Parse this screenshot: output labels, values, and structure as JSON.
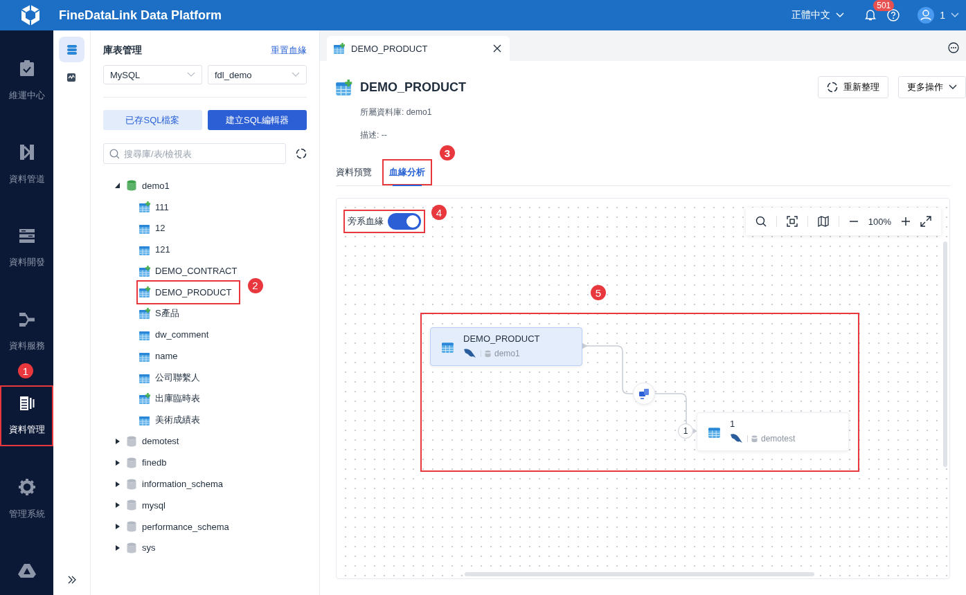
{
  "header": {
    "title": "FineDataLink Data Platform",
    "language": "正體中文",
    "notification_count": "501",
    "user": "1"
  },
  "nav": {
    "items": [
      {
        "label": "維運中心",
        "selected": false,
        "highlighted": false
      },
      {
        "label": "資料管道",
        "selected": false,
        "highlighted": false
      },
      {
        "label": "資料開發",
        "selected": false,
        "highlighted": false
      },
      {
        "label": "資料服務",
        "selected": false,
        "highlighted": false
      },
      {
        "label": "資料管理",
        "selected": true,
        "highlighted": true,
        "callout": "1"
      },
      {
        "label": "管理系統",
        "selected": false,
        "highlighted": false
      }
    ]
  },
  "rail": {
    "items": [
      {
        "selected": true
      },
      {
        "selected": false
      }
    ]
  },
  "panel": {
    "title": "庫表管理",
    "link": "重置血緣",
    "source_select": "MySQL",
    "database_select": "fdl_demo",
    "buttons": [
      {
        "label": "已存SQL檔案",
        "kind": "secondary"
      },
      {
        "label": "建立SQL編輯器",
        "kind": "primary"
      }
    ],
    "search": {
      "placeholder": "搜尋庫/表/檢視表"
    },
    "tree": [
      {
        "label": "demo1",
        "expanded": true,
        "children": [
          {
            "label": "111",
            "kind": "table-linked",
            "highlighted": false
          },
          {
            "label": "12",
            "kind": "table",
            "highlighted": false
          },
          {
            "label": "121",
            "kind": "table",
            "highlighted": false
          },
          {
            "label": "DEMO_CONTRACT",
            "kind": "table-linked",
            "highlighted": false
          },
          {
            "label": "DEMO_PRODUCT",
            "kind": "table-linked",
            "highlighted": true,
            "callout": "2"
          },
          {
            "label": "S產品",
            "kind": "table-linked",
            "highlighted": false
          },
          {
            "label": "dw_comment",
            "kind": "table",
            "highlighted": false
          },
          {
            "label": "name",
            "kind": "table",
            "highlighted": false
          },
          {
            "label": "公司聯繫人",
            "kind": "table",
            "highlighted": false
          },
          {
            "label": "出庫臨時表",
            "kind": "table-linked",
            "highlighted": false
          },
          {
            "label": "美術成績表",
            "kind": "table",
            "highlighted": false
          }
        ]
      },
      {
        "label": "demotest",
        "expanded": false
      },
      {
        "label": "finedb",
        "expanded": false
      },
      {
        "label": "information_schema",
        "expanded": false
      },
      {
        "label": "mysql",
        "expanded": false
      },
      {
        "label": "performance_schema",
        "expanded": false
      },
      {
        "label": "sys",
        "expanded": false
      }
    ]
  },
  "document_tabs": [
    {
      "label": "DEMO_PRODUCT",
      "selected": true
    }
  ],
  "detail": {
    "title": "DEMO_PRODUCT",
    "actions": [
      {
        "label": "重新整理",
        "kind": "refresh"
      },
      {
        "label": "更多操作",
        "kind": "menu"
      }
    ],
    "database_label": "所屬資料庫:",
    "database": "demo1",
    "description_label": "描述:",
    "description": "--",
    "tabs": [
      {
        "label": "資料預覽",
        "selected": false,
        "highlighted": false
      },
      {
        "label": "血緣分析",
        "selected": true,
        "highlighted": true,
        "callout": "3"
      }
    ]
  },
  "lineage": {
    "toggle": {
      "label": "旁系血緣",
      "on": true,
      "highlighted": true,
      "callout": "4"
    },
    "zoom": "100%",
    "diagram": {
      "highlighted": true,
      "callout": "5",
      "edge_label": "1",
      "nodes": [
        {
          "name": "DEMO_PRODUCT",
          "database": "demo1",
          "selected": true
        },
        {
          "name": "1",
          "database": "demotest",
          "selected": false
        }
      ]
    }
  }
}
